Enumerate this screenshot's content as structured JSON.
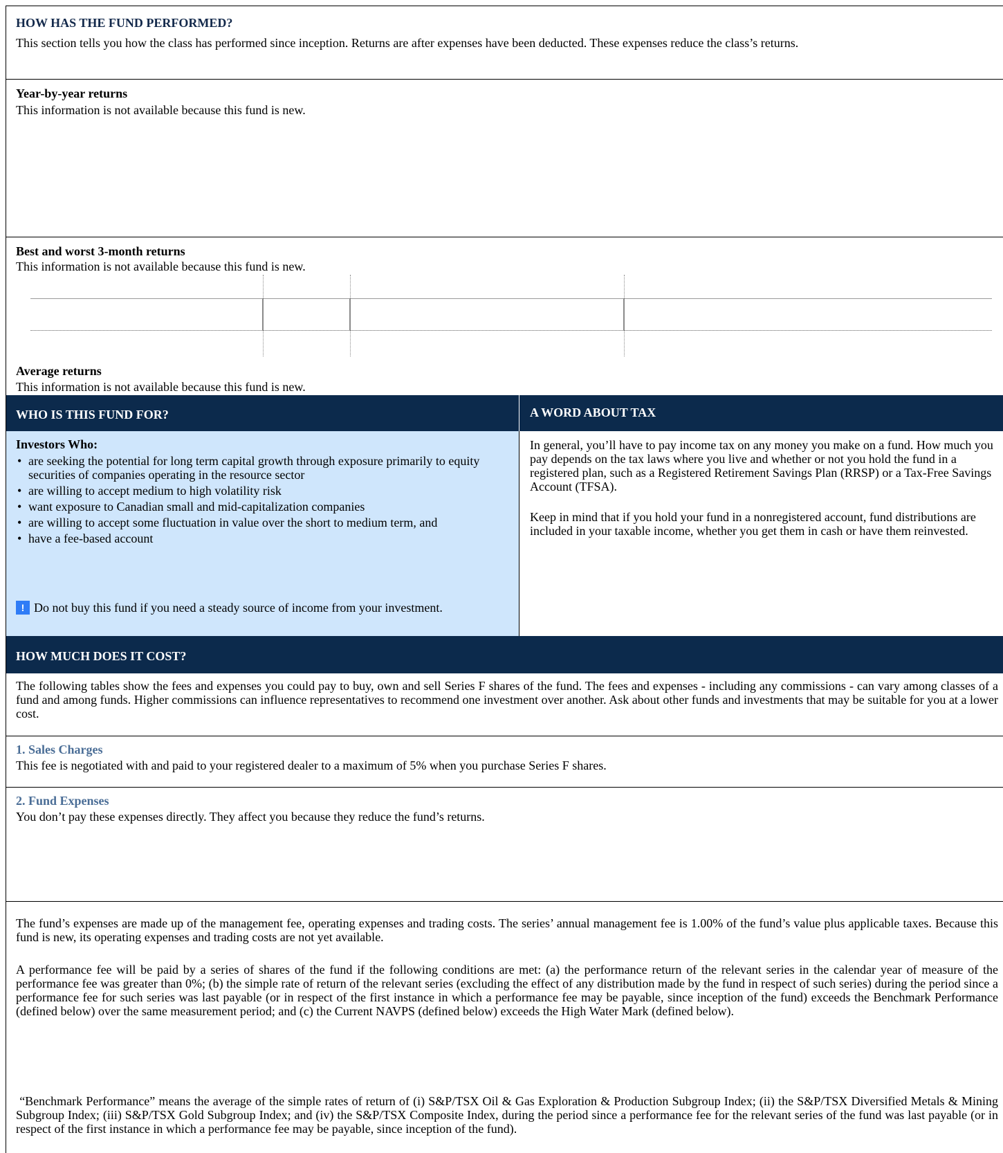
{
  "performance": {
    "title": "HOW HAS THE FUND PERFORMED?",
    "intro": "This section tells you how the class has performed since inception. Returns are after expenses have been deducted. These expenses reduce the class’s returns.",
    "year_by_year_heading": "Year-by-year returns",
    "year_by_year_text": "This information is not available because this fund is new.",
    "best_worst_heading": "Best and worst 3-month returns",
    "best_worst_text": "This information is not available because this fund is new.",
    "average_heading": "Average returns",
    "average_text": "This information is not available because this fund is new."
  },
  "who_for": {
    "title": "WHO IS THIS FUND FOR?",
    "subheading": "Investors Who:",
    "items": [
      "are seeking the potential for long term capital growth through exposure primarily to equity securities of companies operating in the resource sector",
      "are willing to accept medium to high volatility risk",
      "want exposure to Canadian small and mid-capitalization companies",
      "are willing to accept some fluctuation in value over the short to medium term, and",
      "have a fee-based account"
    ],
    "warning_glyph": "!",
    "warning": "Do not buy this fund if you need a steady source of income from your investment.",
    "warning_icon_color": "#2f7cf6"
  },
  "tax": {
    "title": "A WORD ABOUT TAX",
    "para1": "In general, you’ll have to pay income tax on any money you make on a fund. How much you pay depends on the tax laws where you live and whether or not you hold the fund in a registered plan, such as a Registered Retirement Savings Plan (RRSP) or a Tax-Free Savings Account (TFSA).",
    "para2": "Keep in mind that if you hold your fund in a nonregistered account, fund distributions are included in your taxable income, whether you get them in cash or have them reinvested."
  },
  "cost": {
    "title": "HOW MUCH DOES IT COST?",
    "intro": "The following tables show the fees and expenses you could pay to buy, own and sell Series F shares of the fund. The fees and expenses - including any commissions - can vary among classes of a fund and among funds. Higher commissions can influence representatives to recommend one investment over another. Ask about other funds and investments that may be suitable for you at a lower cost.",
    "sales_heading": "1. Sales Charges",
    "sales_text": "This fee is negotiated with and paid to your registered dealer to a maximum of 5% when you purchase Series F shares.",
    "expenses_heading": "2. Fund Expenses",
    "expenses_text": "You don’t pay these expenses directly. They affect you because they reduce the fund’s returns.",
    "para1": "The fund’s expenses are made up of the management fee, operating expenses and trading costs. The series’ annual management fee is 1.00% of the fund’s value plus applicable taxes. Because this fund is new, its operating expenses and trading costs are not yet available.",
    "para2": "A performance fee will be paid by a series of shares of the fund if the following conditions are met: (a) the performance return of the relevant series in the calendar year of measure of the performance fee was greater than 0%; (b) the simple rate of return of the relevant series (excluding the effect of any distribution made by the fund in respect of such series) during the period since a performance fee for such series was last payable (or in respect of the first instance in which a performance fee may be payable, since inception of the fund) exceeds the Benchmark Performance (defined below) over the same measurement period; and (c) the Current NAVPS (defined below) exceeds the High Water Mark (defined below).",
    "para3": " “Benchmark Performance” means the average of the simple rates of return of (i) S&P/TSX Oil & Gas Exploration & Production Subgroup Index; (ii) the S&P/TSX Diversified Metals & Mining Subgroup Index; (iii) S&P/TSX Gold Subgroup Index; and (iv) the S&P/TSX Composite Index, during the period since a performance fee for the relevant series of the fund was last payable (or in respect of the first instance in which a performance fee may be payable, since inception of the fund)."
  },
  "colors": {
    "navy": "#0c2a4c",
    "section_title": "#13294b",
    "subheading_blue": "#4a6d96",
    "light_blue_panel": "#cfe6fc"
  }
}
